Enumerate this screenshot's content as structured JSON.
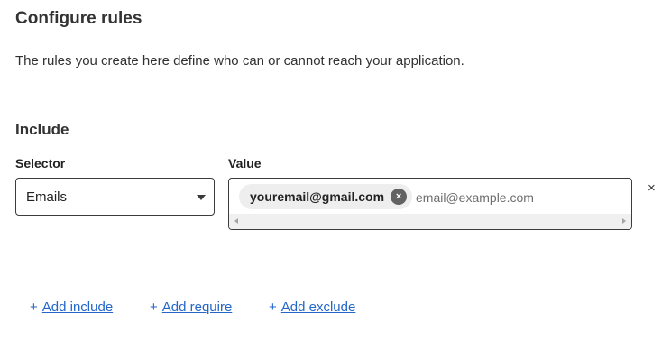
{
  "page": {
    "title": "Configure rules",
    "description": "The rules you create here define who can or cannot reach your application."
  },
  "include": {
    "heading": "Include",
    "selector_label": "Selector",
    "value_label": "Value",
    "selector_value": "Emails",
    "value_chips": [
      "youremail@gmail.com"
    ],
    "chip_remove_glyph": "×",
    "value_placeholder": "email@example.com",
    "row_remove_glyph": "×"
  },
  "actions": {
    "plus_glyph": "+",
    "add_include": "Add include",
    "add_require": "Add require",
    "add_exclude": "Add exclude"
  },
  "colors": {
    "link": "#2366c8",
    "text": "#313131",
    "border": "#3c3c3c",
    "chip_bg": "#eeeeee"
  },
  "icons": {
    "selector_dropdown": "chevron-down-icon",
    "chip_remove": "close-circle-icon",
    "row_remove": "close-icon",
    "action_prefix": "plus-icon"
  }
}
